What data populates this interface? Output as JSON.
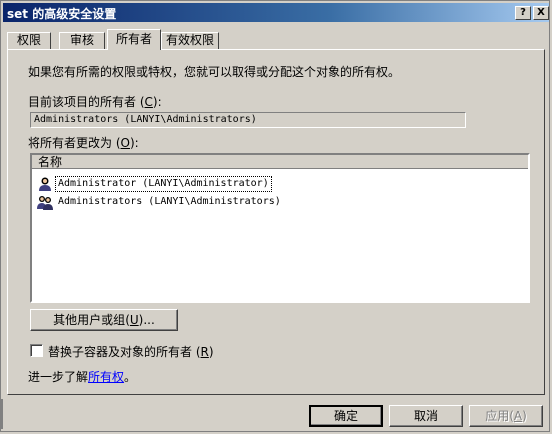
{
  "window": {
    "title": "set 的高级安全设置",
    "help_btn": "?",
    "close_btn": "X"
  },
  "tabs": [
    {
      "label": "权限"
    },
    {
      "label": "审核"
    },
    {
      "label": "所有者"
    },
    {
      "label": "有效权限"
    }
  ],
  "owner_page": {
    "intro": "如果您有所需的权限或特权，您就可以取得或分配这个对象的所有权。",
    "current_owner_label": "目前该项目的所有者",
    "current_owner_key": "C",
    "current_owner_value": "Administrators (LANYI\\Administrators)",
    "change_label": "将所有者更改为",
    "change_key": "O",
    "list_header": "名称",
    "owners": [
      {
        "name": "Administrator (LANYI\\Administrator)",
        "icon": "user-icon",
        "selected": true
      },
      {
        "name": "Administrators (LANYI\\Administrators)",
        "icon": "group-icon",
        "selected": false
      }
    ],
    "other_users_button": "其他用户或组",
    "other_users_key": "U",
    "other_users_suffix": "...",
    "replace_checkbox_label": "替换子容器及对象的所有者",
    "replace_key": "R",
    "learn_more_prefix": "进一步了解",
    "learn_more_link": "所有权",
    "learn_more_suffix": "。"
  },
  "footer": {
    "ok": "确定",
    "cancel": "取消",
    "apply": "应用",
    "apply_key": "A"
  }
}
